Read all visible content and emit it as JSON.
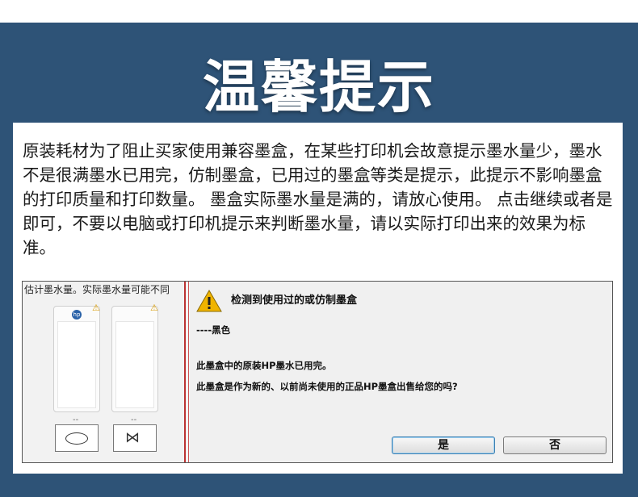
{
  "banner": {
    "title": "温馨提示"
  },
  "notice": {
    "text": "原装耗材为了阻止买家使用兼容墨盒，在某些打印机会故意提示墨水量少，墨水不是很满墨水已用完，仿制墨盒，已用过的墨盒等类是提示，此提示不影响墨盒的打印质量和打印数量。 墨盒实际墨水量是满的，请放心使用。 点击继续或者是即可，不要以电脑或打印机提示来判断墨水量，请以实际打印出来的效果为标准。"
  },
  "screenshot": {
    "left_pane": {
      "header": "估计墨水量。实际墨水量可能不同",
      "cart1_logo": "hp",
      "dash1": "--",
      "dash2": "--"
    },
    "dialog": {
      "title": "检测到使用过的或仿制墨盒",
      "color_line": "----黑色",
      "line1": "此墨盒中的原装HP墨水已用完。",
      "line2": "此墨盒是作为新的、以前尚未使用的正品HP墨盒出售给您的吗?",
      "yes_label": "是",
      "no_label": "否"
    }
  },
  "colors": {
    "background": "#2e5377",
    "warning": "#f0b400",
    "divider": "#b33333"
  }
}
